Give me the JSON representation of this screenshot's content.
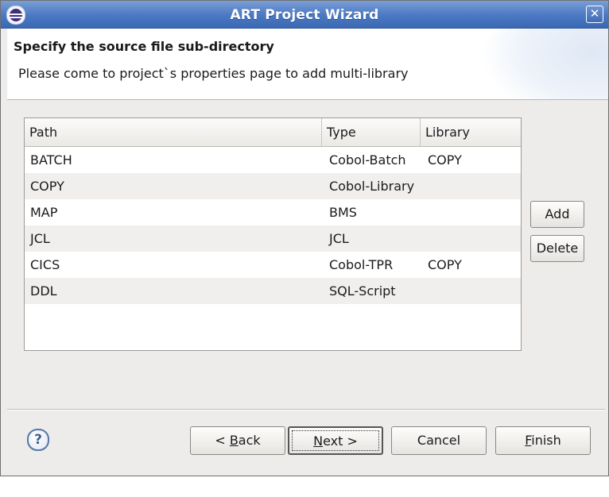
{
  "window": {
    "title": "ART Project Wizard",
    "close_glyph": "✕"
  },
  "header": {
    "title": "Specify the source file sub-directory",
    "description": "Please come to project`s properties page to add multi-library"
  },
  "table": {
    "columns": [
      "Path",
      "Type",
      "Library"
    ],
    "rows": [
      {
        "path": "BATCH",
        "type": "Cobol-Batch",
        "library": "COPY"
      },
      {
        "path": "COPY",
        "type": "Cobol-Library",
        "library": ""
      },
      {
        "path": "MAP",
        "type": "BMS",
        "library": ""
      },
      {
        "path": "JCL",
        "type": "JCL",
        "library": ""
      },
      {
        "path": "CICS",
        "type": "Cobol-TPR",
        "library": "COPY"
      },
      {
        "path": "DDL",
        "type": "SQL-Script",
        "library": ""
      }
    ]
  },
  "side_buttons": {
    "add": "Add",
    "delete": "Delete"
  },
  "footer": {
    "help_glyph": "?",
    "back": {
      "pre": "< ",
      "mnemonic": "B",
      "post": "ack"
    },
    "next": {
      "pre": "",
      "mnemonic": "N",
      "post": "ext >"
    },
    "cancel": "Cancel",
    "finish": {
      "pre": "",
      "mnemonic": "F",
      "post": "inish"
    }
  },
  "icons": {
    "app": "eclipse-icon",
    "close": "close-icon",
    "help": "help-icon"
  }
}
